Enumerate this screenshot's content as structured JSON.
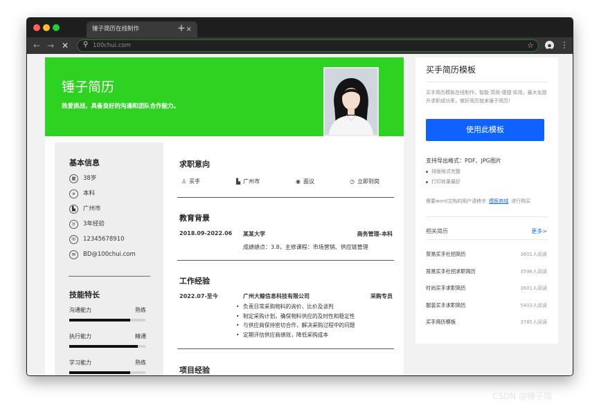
{
  "browser": {
    "tab_title": "锤子简历在线制作",
    "tab_close": "×",
    "new_tab": "+",
    "url": "100chui.com",
    "nav_back": "←",
    "nav_forward": "→",
    "nav_stop": "✕",
    "search_icon": "⚲",
    "star": "☆",
    "menu": "⋮"
  },
  "colors": {
    "traffic_red": "#ff5f57",
    "traffic_yellow": "#febc2e",
    "traffic_green": "#28c840",
    "hero_green": "#2ed321",
    "primary_blue": "#0f62fe",
    "link_blue": "#1a73e8"
  },
  "resume": {
    "name": "锤子简历",
    "motto": "热爱挑战，具备良好的沟通和团队合作能力。",
    "basic_title": "基本信息",
    "basic_info": [
      {
        "icon": "calendar-icon",
        "glyph": "▦",
        "text": "38岁"
      },
      {
        "icon": "education-icon",
        "glyph": "e",
        "text": "本科"
      },
      {
        "icon": "building-icon",
        "glyph": "▙",
        "text": "广州市"
      },
      {
        "icon": "experience-icon",
        "glyph": "≡",
        "text": "3年经验"
      },
      {
        "icon": "phone-icon",
        "glyph": "☏",
        "text": "12345678910"
      },
      {
        "icon": "email-icon",
        "glyph": "✉",
        "text": "BD@100chui.com"
      }
    ],
    "skills_title": "技能特长",
    "skills": [
      {
        "name": "沟通能力",
        "level": "熟练",
        "progress": 0.8
      },
      {
        "name": "执行能力",
        "level": "精通",
        "progress": 0.9
      },
      {
        "name": "学习能力",
        "level": "熟练",
        "progress": 0.8
      }
    ],
    "intent_title": "求职意向",
    "intent": {
      "job": {
        "glyph": "♙",
        "text": "买手"
      },
      "city": {
        "glyph": "▙",
        "text": "广州市"
      },
      "salary": {
        "glyph": "◉",
        "text": "面议"
      },
      "availability": {
        "glyph": "◷",
        "text": "立即到岗"
      }
    },
    "education_title": "教育背景",
    "education": {
      "period": "2018.09-2022.06",
      "school": "某某大学",
      "major": "商务管理-本科",
      "details": "成绩绩点：3.8，主修课程：市场营销、供应链管理"
    },
    "work_title": "工作经验",
    "work": {
      "period": "2022.07-至今",
      "company": "广州大鲸信息科技有限公司",
      "position": "采购专员",
      "bullets": [
        "负责日常采购物料的询价、比价及谈判",
        "制定采购计划，确保物料供应的及时性和稳定性",
        "与供应商保持密切合作，解决采购过程中的问题",
        "定期评估供应商绩效，降低采购成本"
      ]
    },
    "project_title": "项目经验"
  },
  "panel": {
    "title": "买手简历模板",
    "description": "买手简历模板在线制作，智能·高效·便捷·实用，最大化提升求职成功率，做好简历就来锤子简历！",
    "use_button": "使用此模板",
    "formats": "支持导出格式：PDF、JPG图片",
    "features": [
      "排版格式完整",
      "打印效果最好"
    ],
    "word_prefix": "需要word文档的用户请移步",
    "word_link": "模板商城",
    "word_suffix": "进行购买",
    "related_title": "相关简历",
    "more": "更多>",
    "related": [
      {
        "title": "贸易买手社招简历",
        "views": "3601人阅读"
      },
      {
        "title": "贸易买手社招求职简历",
        "views": "3596人阅读"
      },
      {
        "title": "时尚买手求职简历",
        "views": "3601人阅读"
      },
      {
        "title": "服装买手求职简历",
        "views": "5403人阅读"
      },
      {
        "title": "买手简历模板",
        "views": "3785人阅读"
      }
    ]
  },
  "watermark": "CSDN @锤子简"
}
